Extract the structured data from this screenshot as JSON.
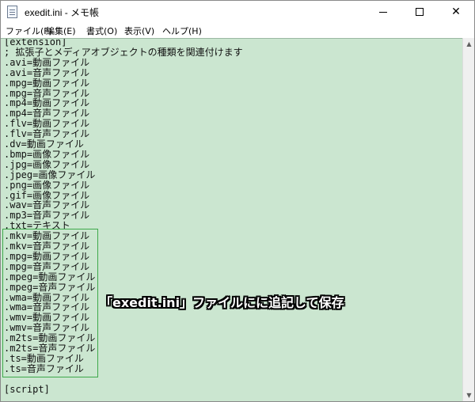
{
  "window": {
    "title": "exedit.ini - メモ帳",
    "icon": "notepad-icon",
    "controls": {
      "minimize": "minimize-icon",
      "maximize": "maximize-icon",
      "close": "✕"
    }
  },
  "menu": [
    {
      "label": "ファイル(F)"
    },
    {
      "label": "編集(E)"
    },
    {
      "label": "書式(O)"
    },
    {
      "label": "表示(V)"
    },
    {
      "label": "ヘルプ(H)"
    }
  ],
  "editor": {
    "background": "#cbe6d0",
    "lines": [
      "[extension]",
      "; 拡張子とメディアオブジェクトの種類を関連付けます",
      ".avi=動画ファイル",
      ".avi=音声ファイル",
      ".mpg=動画ファイル",
      ".mpg=音声ファイル",
      ".mp4=動画ファイル",
      ".mp4=音声ファイル",
      ".flv=動画ファイル",
      ".flv=音声ファイル",
      ".dv=動画ファイル",
      ".bmp=画像ファイル",
      ".jpg=画像ファイル",
      ".jpeg=画像ファイル",
      ".png=画像ファイル",
      ".gif=画像ファイル",
      ".wav=音声ファイル",
      ".mp3=音声ファイル",
      ".txt=テキスト",
      ".mkv=動画ファイル",
      ".mkv=音声ファイル",
      ".mpg=動画ファイル",
      ".mpg=音声ファイル",
      ".mpeg=動画ファイル",
      ".mpeg=音声ファイル",
      ".wma=動画ファイル",
      ".wma=音声ファイル",
      ".wmv=動画ファイル",
      ".wmv=音声ファイル",
      ".m2ts=動画ファイル",
      ".m2ts=音声ファイル",
      ".ts=動画ファイル",
      ".ts=音声ファイル",
      "",
      "[script]"
    ]
  },
  "annotation": {
    "text": "「exedit.ini」ファイルにに追記して保存",
    "box_color": "#3ea84a"
  },
  "scrollbar": {
    "up_icon": "▲",
    "down_icon": "▼"
  }
}
